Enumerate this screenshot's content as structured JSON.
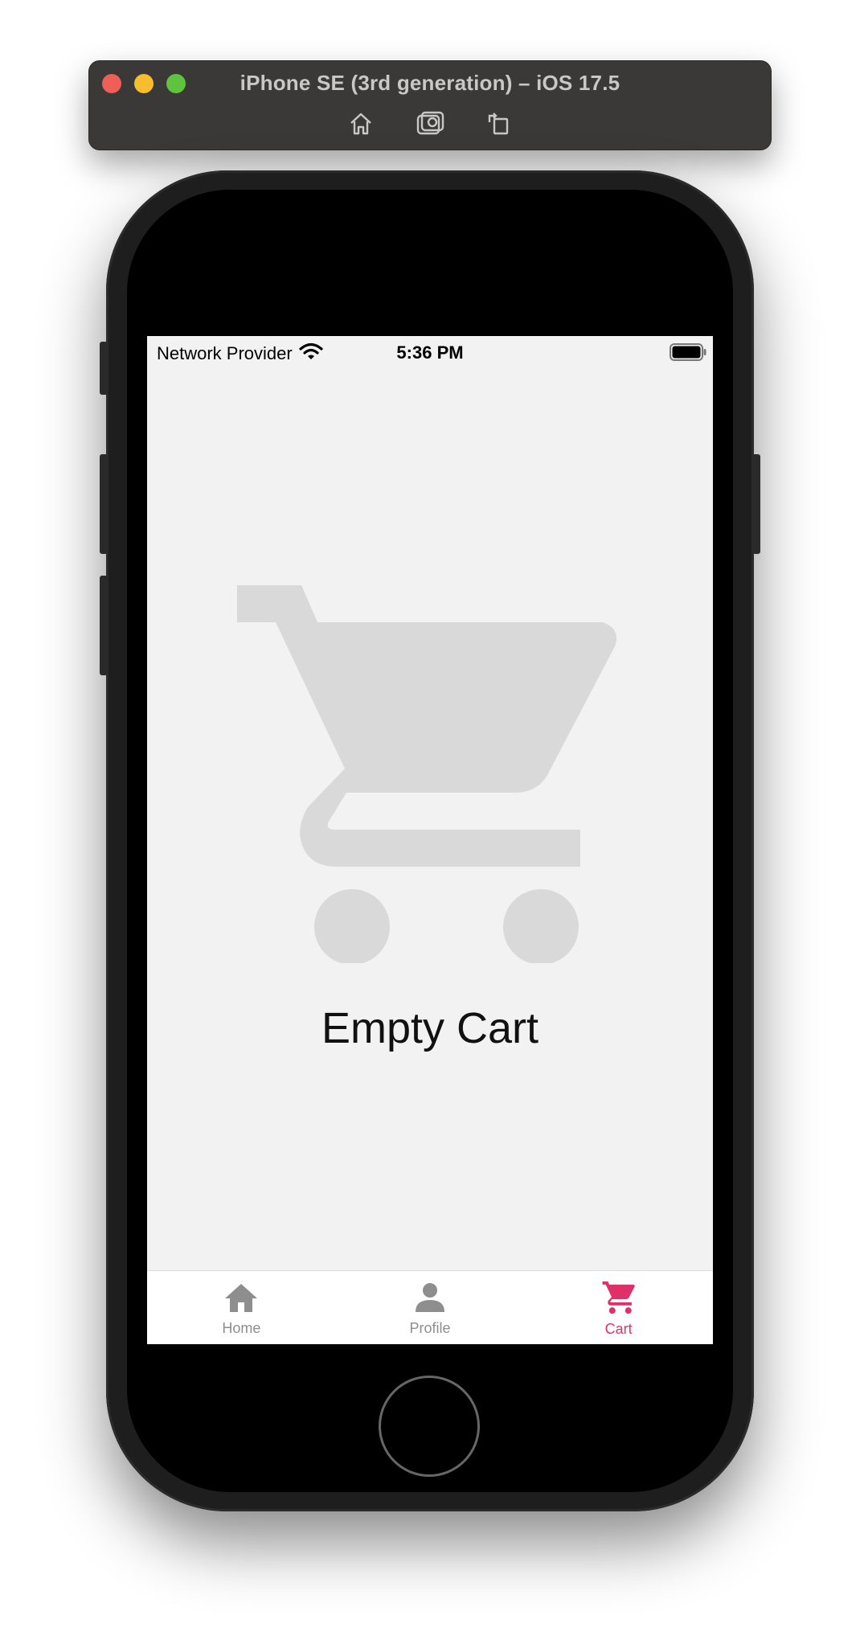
{
  "window": {
    "title": "iPhone SE (3rd generation) – iOS 17.5",
    "traffic_colors": {
      "close": "#ee5f57",
      "minimize": "#f6bd2f",
      "maximize": "#60c33d"
    },
    "tools": [
      {
        "name": "home-icon"
      },
      {
        "name": "screenshot-icon"
      },
      {
        "name": "rotate-icon"
      }
    ]
  },
  "status_bar": {
    "carrier": "Network Provider",
    "time": "5:36 PM"
  },
  "empty_state": {
    "title": "Empty Cart",
    "icon": "shopping-cart-icon",
    "icon_color": "#d9d9d9"
  },
  "tab_bar": {
    "active_color": "#e0306a",
    "inactive_color": "#8e8e8e",
    "tabs": [
      {
        "label": "Home",
        "icon": "home-icon",
        "active": false
      },
      {
        "label": "Profile",
        "icon": "person-icon",
        "active": false
      },
      {
        "label": "Cart",
        "icon": "cart-icon",
        "active": true
      }
    ]
  }
}
